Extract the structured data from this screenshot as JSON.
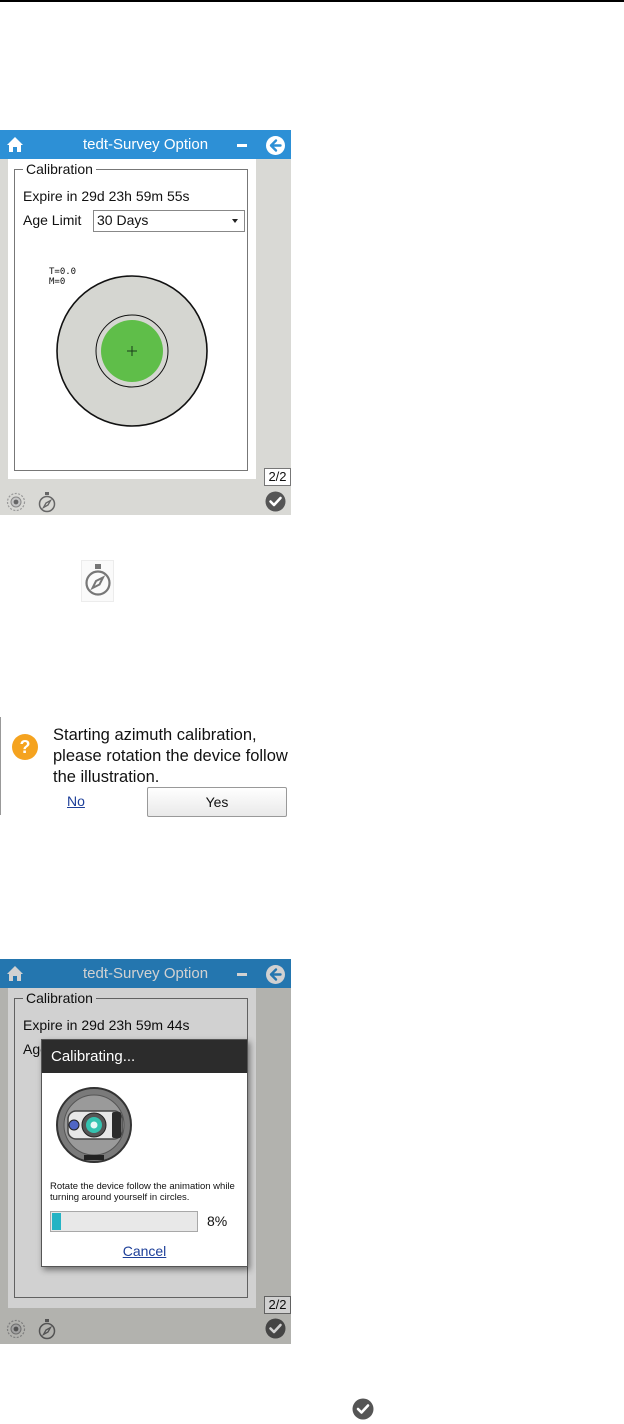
{
  "screen1": {
    "title": "tedt-Survey Option",
    "group_label": "Calibration",
    "expire_text": "Expire in 29d 23h 59m 55s",
    "age_limit_label": "Age Limit",
    "age_limit_value": "30 Days",
    "t_value": "T=0.0",
    "m_value": "M=0",
    "page_indicator": "2/2"
  },
  "dialog": {
    "message": "Starting azimuth calibration, please rotation the device follow the illustration.",
    "no_label": "No",
    "yes_label": "Yes"
  },
  "screen2": {
    "title": "tedt-Survey Option",
    "group_label": "Calibration",
    "expire_text": "Expire in 29d 23h 59m 44s",
    "age_label_partial": "Age",
    "page_indicator": "2/2",
    "modal": {
      "title": "Calibrating...",
      "instruction": "Rotate the device follow the animation while turning around yourself in circles.",
      "progress_percent": 8,
      "progress_text": "8%",
      "cancel_label": "Cancel"
    }
  },
  "colors": {
    "titlebar": "#2d90d6",
    "target_green": "#5fbe49",
    "progress": "#25b3c4",
    "panel_gray": "#d9d9d5"
  }
}
